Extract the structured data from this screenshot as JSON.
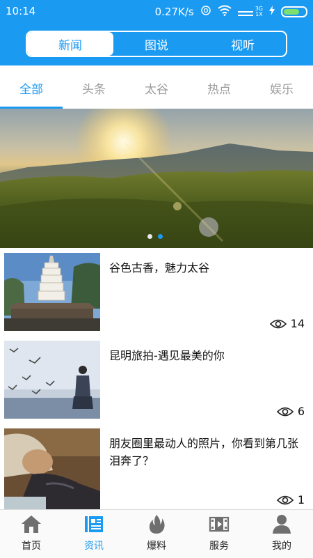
{
  "status_bar": {
    "time": "10:14",
    "network_speed": "0.27K/s",
    "signal_top": "3G",
    "signal_bottom": "1X"
  },
  "header": {
    "segments": [
      {
        "label": "新闻",
        "active": true
      },
      {
        "label": "图说",
        "active": false
      },
      {
        "label": "视听",
        "active": false
      }
    ]
  },
  "category_tabs": [
    {
      "label": "全部",
      "active": true
    },
    {
      "label": "头条",
      "active": false
    },
    {
      "label": "太谷",
      "active": false
    },
    {
      "label": "热点",
      "active": false
    },
    {
      "label": "娱乐",
      "active": false
    }
  ],
  "banner": {
    "slide_count": 2,
    "active_slide": 2
  },
  "news": [
    {
      "title": "谷色古香，魅力太谷",
      "views": "14",
      "thumbnail": "pagoda-photo"
    },
    {
      "title": "昆明旅拍-遇见最美的你",
      "views": "6",
      "thumbnail": "seagulls-photo"
    },
    {
      "title": "朋友圈里最动人的照片，你看到第几张泪奔了？",
      "views": "1",
      "thumbnail": "elderly-person-photo"
    }
  ],
  "bottom_nav": [
    {
      "label": "首页",
      "icon": "home-icon",
      "active": false
    },
    {
      "label": "资讯",
      "icon": "newspaper-icon",
      "active": true
    },
    {
      "label": "爆料",
      "icon": "flame-icon",
      "active": false
    },
    {
      "label": "服务",
      "icon": "film-icon",
      "active": false
    },
    {
      "label": "我的",
      "icon": "user-icon",
      "active": false
    }
  ],
  "colors": {
    "accent": "#1b9af2",
    "inactive_tab": "#9b9b9b",
    "battery": "#7ee06e"
  }
}
